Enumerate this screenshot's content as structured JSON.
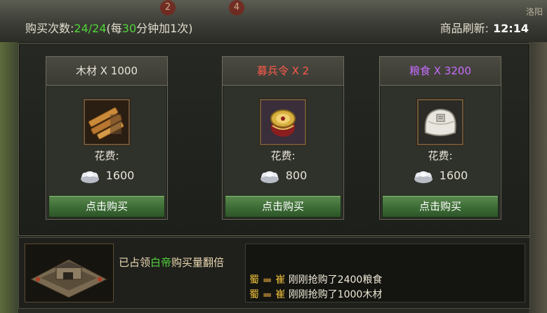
{
  "header": {
    "purchase_label": "购买次数:",
    "purchase_count": "24/24",
    "rule_prefix": "(每",
    "rule_minutes": "30",
    "rule_suffix": "分钟加1次)",
    "refresh_label": "商品刷新:",
    "refresh_time": "12:14",
    "badges": [
      "2",
      "4"
    ],
    "corner_text": "洛阳"
  },
  "items": [
    {
      "title": "木材 X 1000",
      "title_color": "#f0ece0",
      "icon": "wood-icon",
      "cost_label": "花费:",
      "currency_icon": "silver-ingot-icon",
      "price": "1600",
      "button": "点击购买"
    },
    {
      "title": "募兵令 X 2",
      "title_color": "#ff5a4a",
      "icon": "recruit-token-icon",
      "cost_label": "花费:",
      "currency_icon": "silver-ingot-icon",
      "price": "800",
      "button": "点击购买"
    },
    {
      "title": "粮食 X 3200",
      "title_color": "#c86cff",
      "icon": "grain-sack-icon",
      "cost_label": "花费:",
      "currency_icon": "silver-ingot-icon",
      "price": "1600",
      "button": "点击购买"
    }
  ],
  "bottom": {
    "occupy_prefix": "已占领",
    "occupy_city": "白帝",
    "occupy_suffix": "购买量翻倍",
    "city_icon": "fortress-city-icon"
  },
  "log": [
    {
      "kingdom": "蜀",
      "name": "崔",
      "message": "刚刚抢购了2400粮食"
    },
    {
      "kingdom": "蜀",
      "name": "崔",
      "message": "刚刚抢购了1000木材"
    }
  ],
  "colors": {
    "highlight_green": "#52d33d",
    "kingdom_gold": "#f2c23c",
    "button_green": "#3f6f38"
  }
}
